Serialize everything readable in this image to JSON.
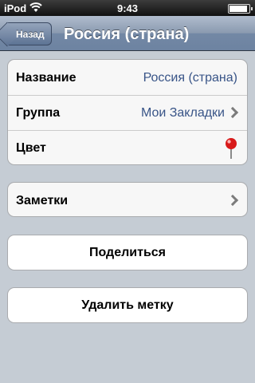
{
  "status_bar": {
    "carrier": "iPod",
    "time": "9:43",
    "wifi_icon": "wifi-icon",
    "battery_icon": "battery-icon",
    "battery_level": 0.9
  },
  "nav": {
    "back_label": "Назад",
    "title": "Россия (страна)"
  },
  "info": {
    "name_label": "Название",
    "name_value": "Россия (страна)",
    "group_label": "Группа",
    "group_value": "Мои Закладки",
    "color_label": "Цвет",
    "color_icon": "red-pin-icon",
    "pin_color": "#d81a1a"
  },
  "notes": {
    "label": "Заметки"
  },
  "actions": {
    "share_label": "Поделиться",
    "delete_label": "Удалить метку"
  }
}
